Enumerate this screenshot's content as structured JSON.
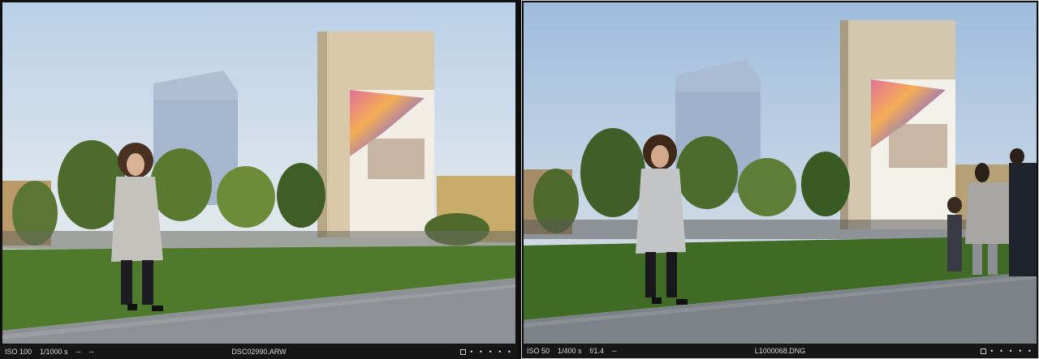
{
  "viewer": {
    "left": {
      "iso": "ISO 100",
      "shutter": "1/1000 s",
      "aperture": "--",
      "extra": "--",
      "filename": "DSC02990.ARW",
      "rating_dots": "• • • • •",
      "selected": false
    },
    "right": {
      "iso": "ISO 50",
      "shutter": "1/400 s",
      "aperture": "f/1.4",
      "extra": "--",
      "filename": "L1000068.DNG",
      "rating_dots": "• • • • •",
      "selected": true
    }
  },
  "colors": {
    "background": "#1c1c1c",
    "infobar": "#161616",
    "selected_border": "#cfcfcf",
    "text": "#d6d6d6"
  }
}
